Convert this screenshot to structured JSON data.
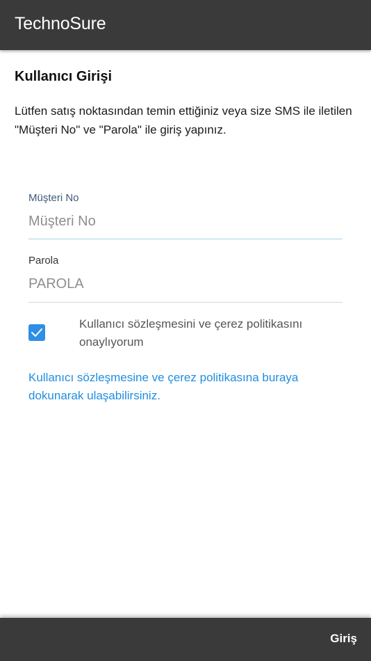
{
  "app_bar": {
    "title": "TechnoSure"
  },
  "page": {
    "heading": "Kullanıcı Girişi",
    "intro": "Lütfen satış noktasından temin ettiğiniz veya size SMS ile iletilen \"Müşteri No\" ve \"Parola\" ile giriş yapınız."
  },
  "form": {
    "customer_no": {
      "label": "Müşteri No",
      "placeholder": "Müşteri No",
      "value": ""
    },
    "password": {
      "label": "Parola",
      "placeholder": "PAROLA",
      "value": ""
    },
    "agreement": {
      "checked": true,
      "label": "Kullanıcı sözleşmesini ve çerez politikasını onaylıyorum"
    },
    "policy_link": "Kullanıcı sözleşmesine ve çerez politikasına buraya dokunarak ulaşabilirsiniz."
  },
  "bottom_bar": {
    "login_label": "Giriş"
  },
  "colors": {
    "bar": "#3a3a3a",
    "accent": "#2f8fe4",
    "link": "#1f8ee0",
    "label_focused": "#3d5a7a"
  },
  "icons": {
    "checkbox": "check-icon"
  }
}
